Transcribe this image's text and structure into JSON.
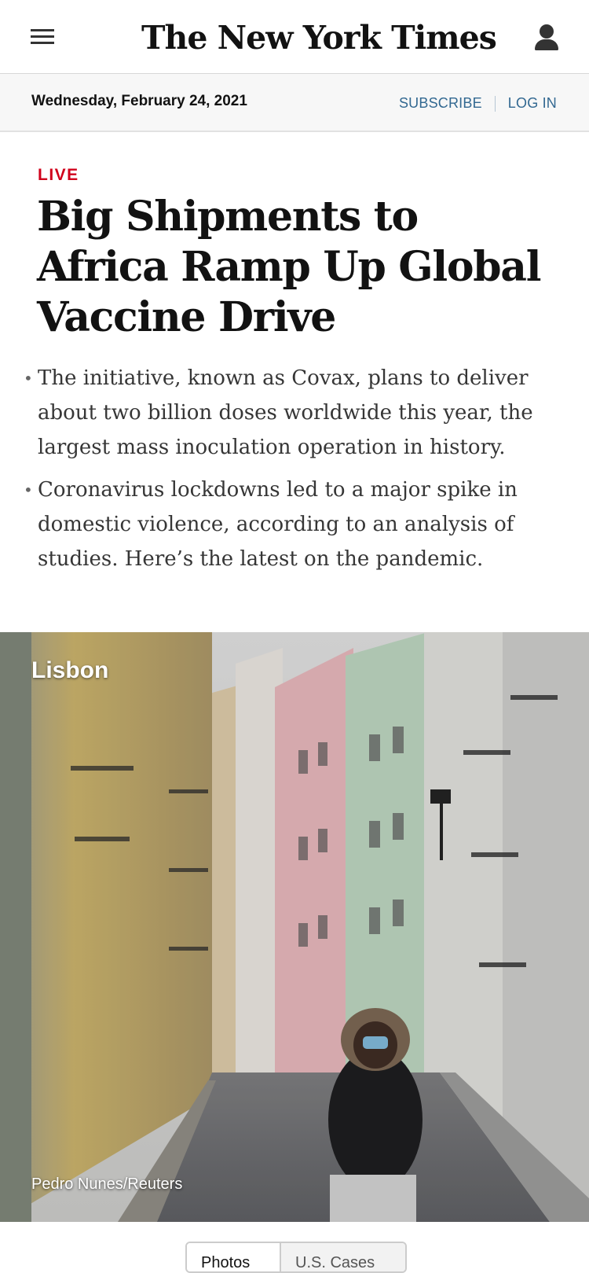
{
  "header": {
    "logo_text": "The New York Times",
    "menu_icon": "hamburger-menu-icon",
    "account_icon": "person-icon"
  },
  "datebar": {
    "date": "Wednesday, February 24, 2021",
    "subscribe_label": "SUBSCRIBE",
    "login_label": "LOG IN"
  },
  "article": {
    "live_label": "LIVE",
    "headline": "Big Shipments to Africa Ramp Up Global Vaccine Drive",
    "summary": [
      "The initiative, known as Covax, plans to deliver about two billion doses worldwide this year, the largest mass inoculation operation in history.",
      "Coronavirus lockdowns led to a major spike in domestic violence, according to an analysis of studies. Here’s the latest on the pandemic."
    ]
  },
  "photo": {
    "location_label": "Lisbon",
    "credit": "Pedro Nunes/Reuters"
  },
  "tabs": [
    {
      "label": "Photos",
      "active": true
    },
    {
      "label": "U.S. Cases",
      "active": false
    }
  ],
  "colors": {
    "accent_red": "#d0021b",
    "link_blue": "#326891",
    "text_dark": "#121212",
    "datebar_bg": "#f7f7f7"
  }
}
